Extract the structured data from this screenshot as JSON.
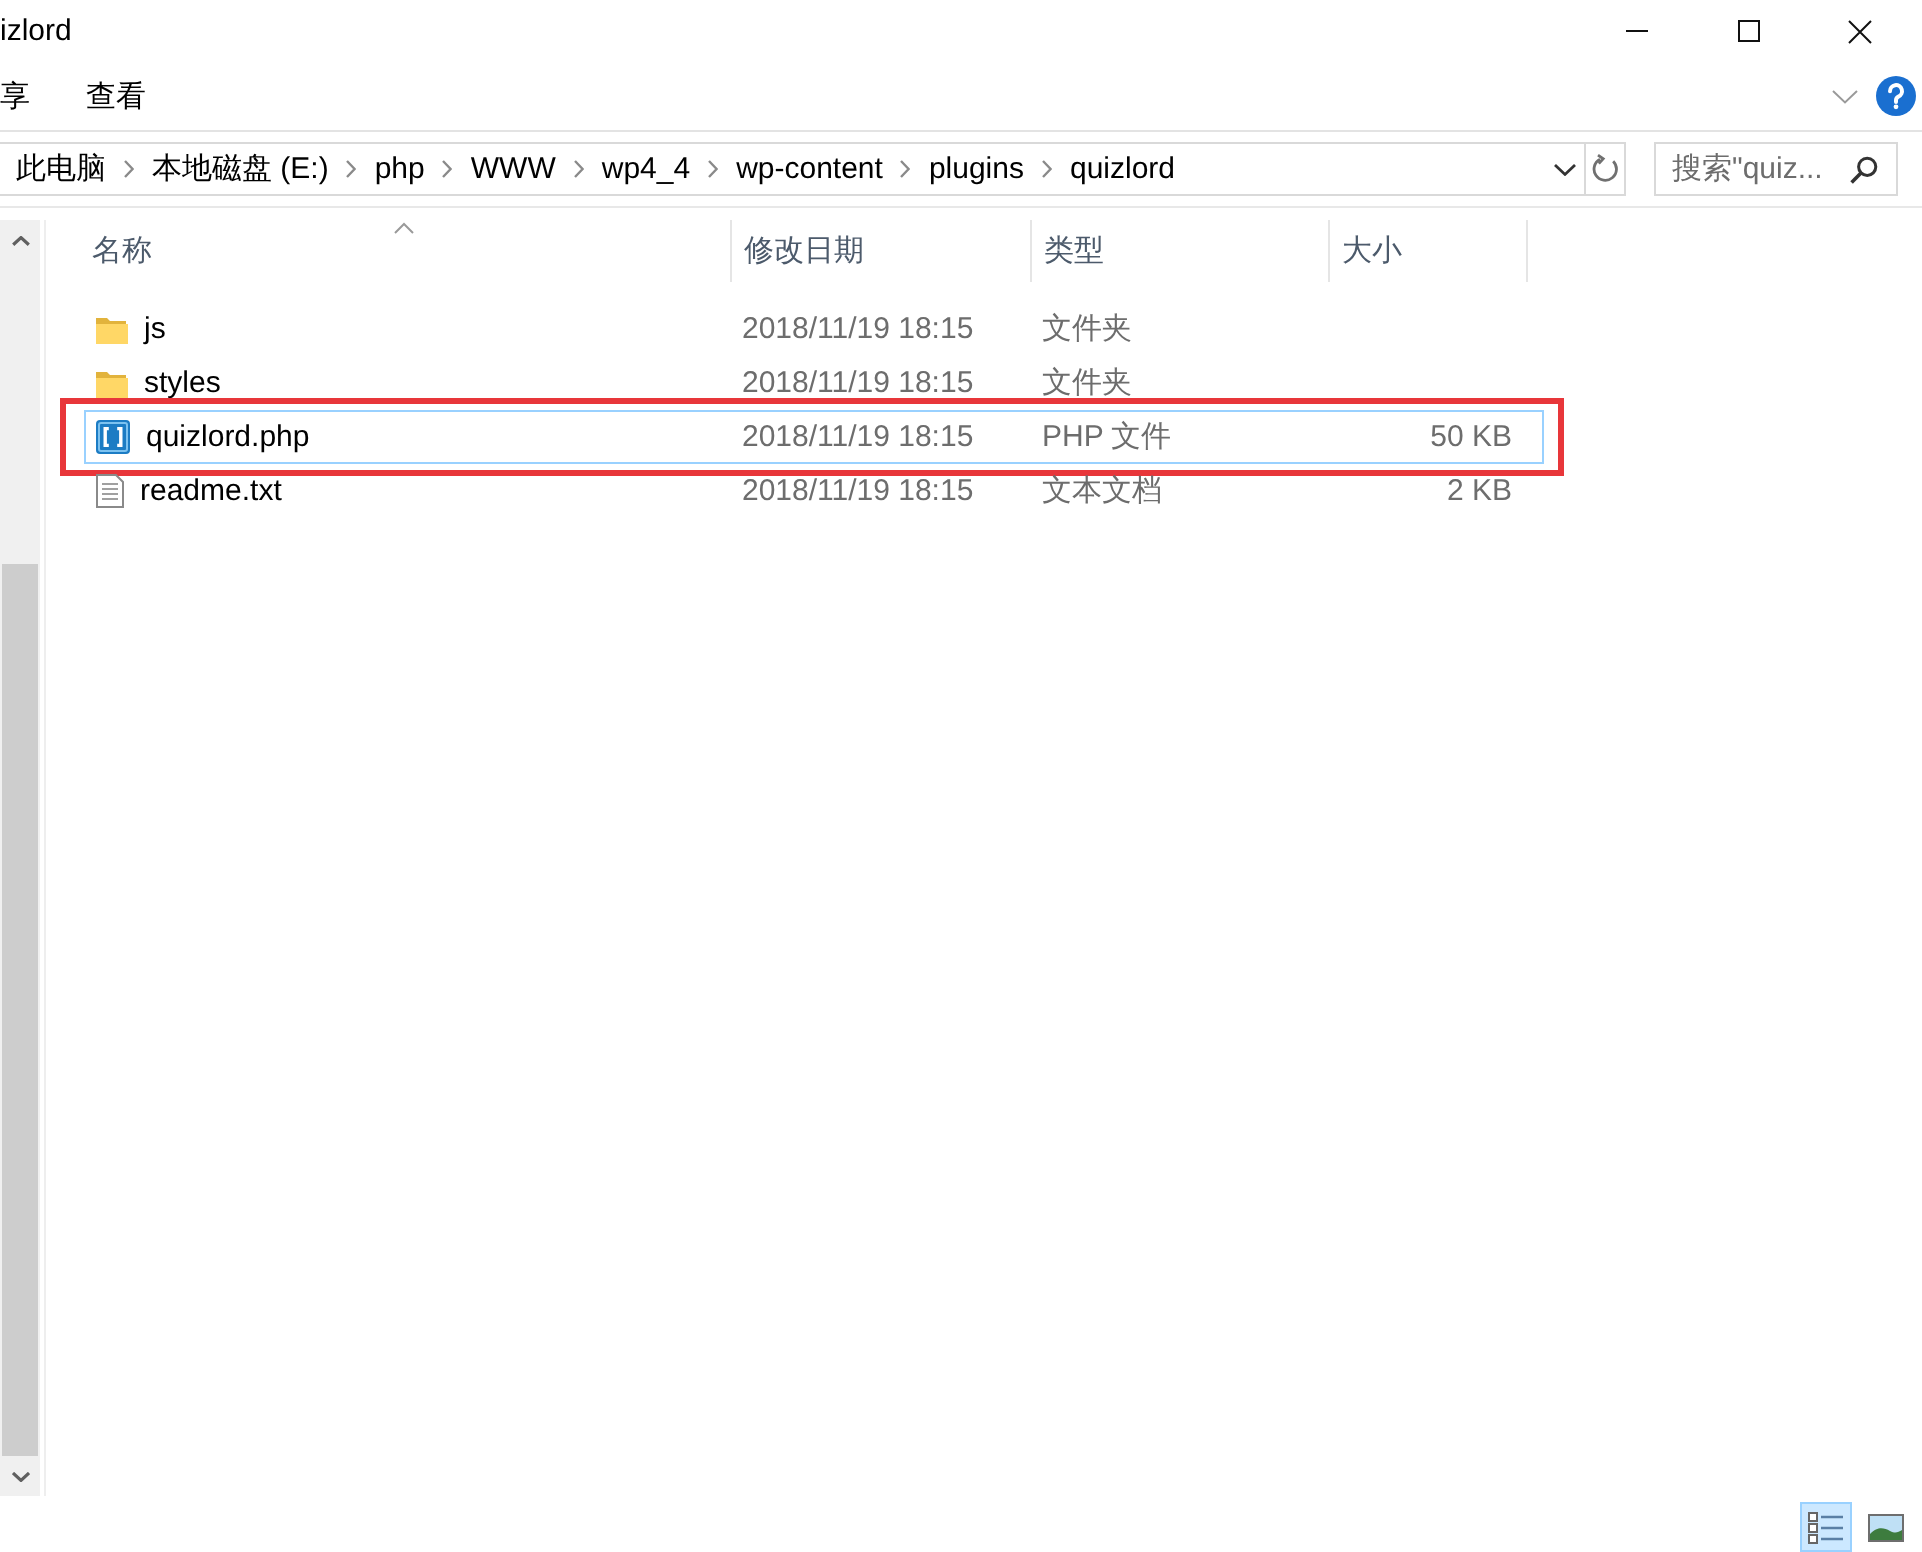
{
  "window": {
    "title": "izlord"
  },
  "ribbon": {
    "tabs": [
      {
        "label": "享"
      },
      {
        "label": "查看"
      }
    ]
  },
  "address_bar": {
    "breadcrumbs": [
      "此电脑",
      "本地磁盘 (E:)",
      "php",
      "WWW",
      "wp4_4",
      "wp-content",
      "plugins",
      "quizlord"
    ]
  },
  "search": {
    "placeholder": "搜索\"quiz..."
  },
  "file_list": {
    "columns": [
      {
        "label": "名称",
        "sorted": true
      },
      {
        "label": "修改日期",
        "sorted": false
      },
      {
        "label": "类型",
        "sorted": false
      },
      {
        "label": "大小",
        "sorted": false
      }
    ],
    "rows": [
      {
        "kind": "folder",
        "name": "js",
        "modified": "2018/11/19 18:15",
        "type": "文件夹",
        "selected": false,
        "annotated": false
      },
      {
        "kind": "folder",
        "name": "styles",
        "modified": "2018/11/19 18:15",
        "type": "文件夹",
        "selected": false,
        "annotated": false
      },
      {
        "kind": "php",
        "name": "quizlord.php",
        "modified": "2018/11/19 18:15",
        "type": "PHP 文件",
        "size": "50 KB",
        "selected": true,
        "annotated": true
      },
      {
        "kind": "text",
        "name": "readme.txt",
        "modified": "2018/11/19 18:15",
        "type": "文本文档",
        "size": "2 KB",
        "selected": false,
        "annotated": false
      }
    ]
  },
  "view_buttons": [
    {
      "kind": "details",
      "selected": true
    },
    {
      "kind": "large-icons",
      "selected": false
    }
  ]
}
